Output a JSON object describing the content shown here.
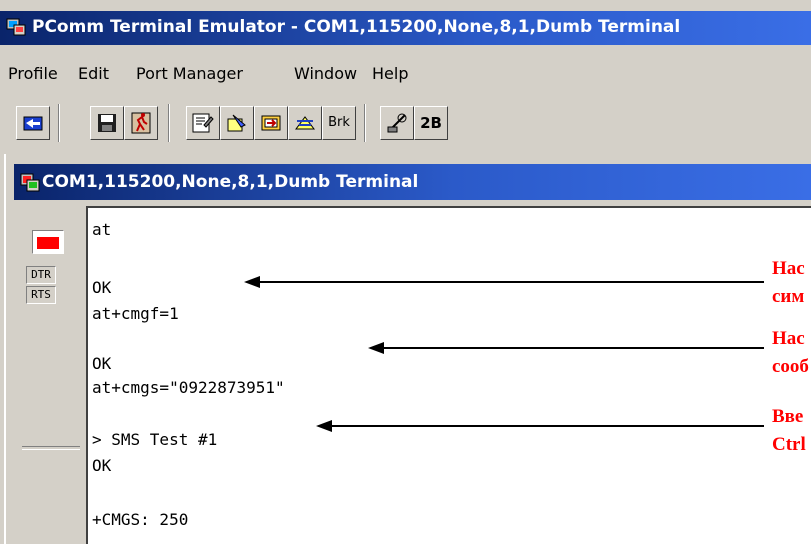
{
  "window": {
    "title": "PComm Terminal Emulator - COM1,115200,None,8,1,Dumb Terminal"
  },
  "menu": [
    "Profile",
    "Edit",
    "Port Manager",
    "Window",
    "Help"
  ],
  "toolbar": {
    "icons": [
      "open-icon",
      "save-icon",
      "exit-icon",
      "properties-icon",
      "send-file-icon",
      "receive-file-icon",
      "transfer-icon",
      "serial-icon"
    ],
    "brk_label": "Brk",
    "twob_label": "2B"
  },
  "child": {
    "title": "COM1,115200,None,8,1,Dumb Terminal"
  },
  "signals": {
    "dtr": "DTR",
    "rts": "RTS",
    "led_color": "#ff0000"
  },
  "terminal": {
    "lines": [
      "at",
      "OK",
      "at+cmgf=1",
      "OK",
      "at+cmgs=\"0922873951\"",
      "> SMS Test #1",
      "OK",
      "+CMGS: 250"
    ]
  },
  "annotations": [
    {
      "line1": "Нас",
      "line2": "сим"
    },
    {
      "line1": "Нас",
      "line2": "сооб"
    },
    {
      "line1": "Вве",
      "line2": "Ctrl"
    }
  ],
  "colors": {
    "annotation": "#ff0000",
    "titlebar": "#0a246a"
  }
}
